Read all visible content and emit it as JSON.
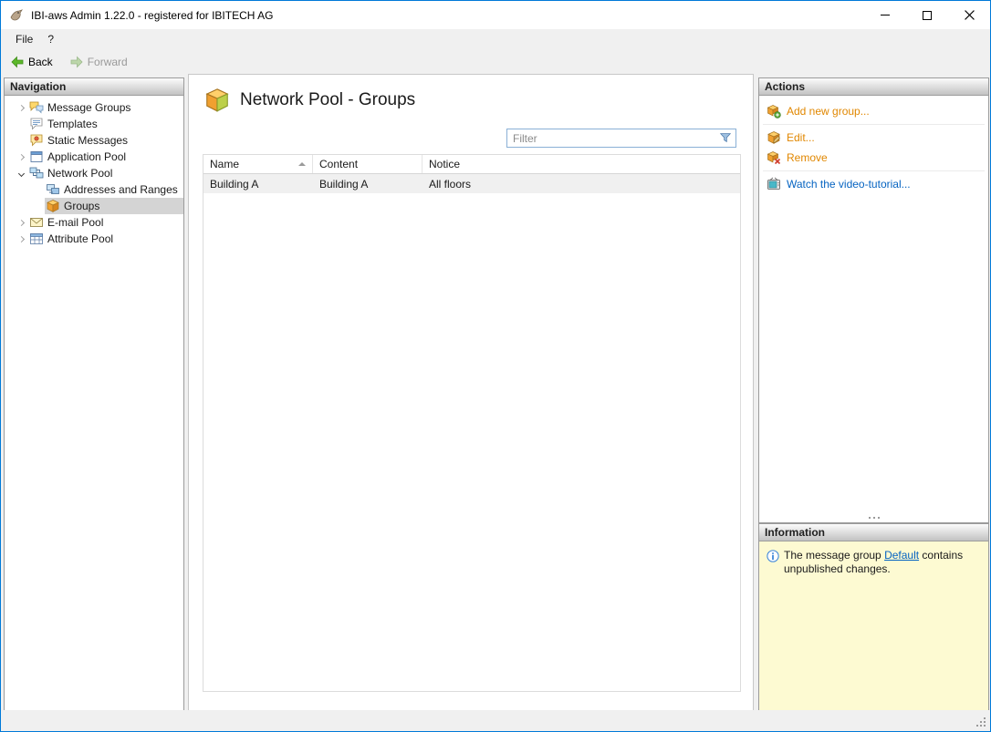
{
  "window": {
    "title": "IBI-aws Admin 1.22.0 - registered for IBITECH AG"
  },
  "menu": {
    "file": "File",
    "help": "?"
  },
  "toolbar": {
    "back": "Back",
    "forward": "Forward"
  },
  "navigation": {
    "header": "Navigation",
    "items": [
      {
        "label": "Message Groups",
        "state": "collapsed"
      },
      {
        "label": "Templates",
        "state": "leaf"
      },
      {
        "label": "Static Messages",
        "state": "leaf"
      },
      {
        "label": "Application Pool",
        "state": "collapsed"
      },
      {
        "label": "Network Pool",
        "state": "expanded"
      },
      {
        "label": "Addresses and Ranges",
        "state": "child"
      },
      {
        "label": "Groups",
        "state": "child-selected"
      },
      {
        "label": "E-mail Pool",
        "state": "collapsed"
      },
      {
        "label": "Attribute Pool",
        "state": "collapsed"
      }
    ]
  },
  "main": {
    "title": "Network Pool - Groups",
    "filter_placeholder": "Filter",
    "table": {
      "columns": [
        "Name",
        "Content",
        "Notice"
      ],
      "sorted_column": "Name",
      "sort_direction": "ascending",
      "rows": [
        [
          "Building A",
          "Building A",
          "All floors"
        ]
      ]
    }
  },
  "actions": {
    "header": "Actions",
    "add": "Add new group...",
    "edit": "Edit...",
    "remove": "Remove",
    "tutorial": "Watch the video-tutorial..."
  },
  "information": {
    "header": "Information",
    "text_before": "The message group ",
    "link": "Default",
    "text_after": " contains unpublished changes."
  },
  "colors": {
    "window_border": "#0079d8",
    "action_link": "#e18700",
    "link_blue": "#0563c1",
    "info_bg": "#fdfad2",
    "selected_row_bg": "#d4d4d4",
    "table_row_bg": "#f0f0f0"
  }
}
